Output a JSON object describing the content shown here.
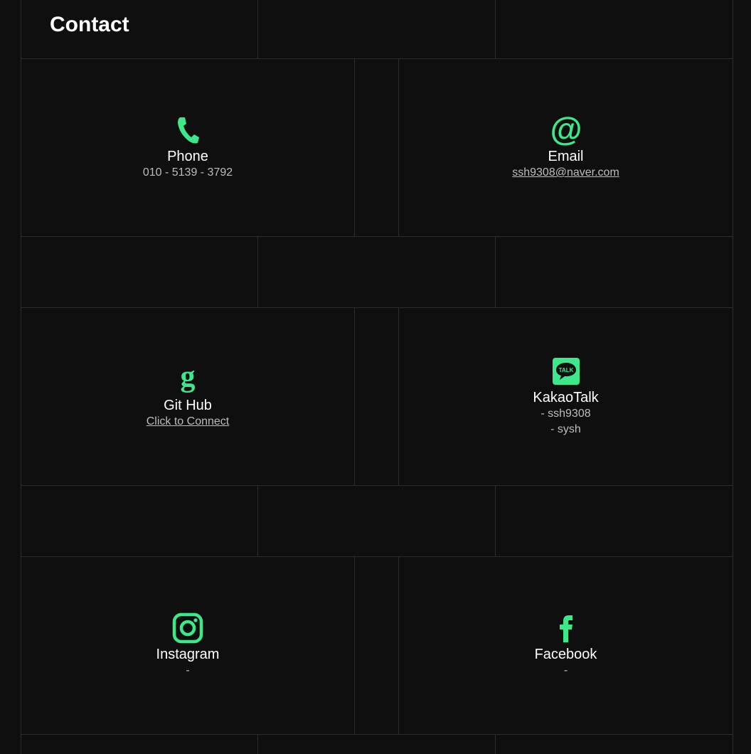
{
  "section": {
    "title": "Contact"
  },
  "contacts": {
    "phone": {
      "label": "Phone",
      "value": "010 - 5139 - 3792",
      "icon": "phone-icon"
    },
    "email": {
      "label": "Email",
      "value": "ssh9308@naver.com",
      "icon": "at-icon"
    },
    "github": {
      "label": "Git Hub",
      "value": "Click to Connect",
      "icon": "github-icon"
    },
    "kakao": {
      "label": "KakaoTalk",
      "value1": "- ssh9308",
      "value2": "- sysh",
      "icon": "kakaotalk-icon",
      "badge": "TALK"
    },
    "instagram": {
      "label": "Instagram",
      "value": "-",
      "icon": "instagram-icon"
    },
    "facebook": {
      "label": "Facebook",
      "value": "-",
      "icon": "facebook-icon"
    }
  },
  "colors": {
    "accent": "#3de88a",
    "background": "#0f0f0f",
    "grid": "#2c2c2c"
  }
}
